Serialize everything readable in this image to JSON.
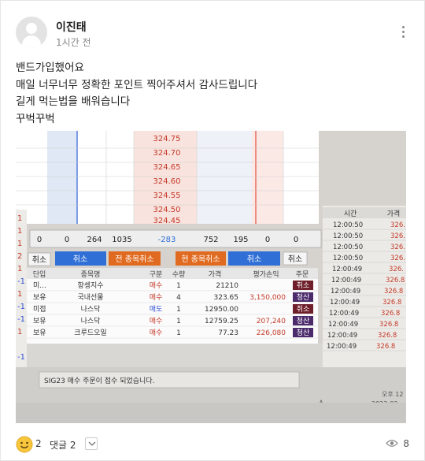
{
  "post": {
    "author": "이진태",
    "time": "1시간 전",
    "body_lines": [
      "밴드가입했어요",
      "매일 너무너무 정확한 포인트 찍어주셔서 감사드립니다",
      "길게 먹는법을 배워습니다",
      "꾸벅꾸벅"
    ]
  },
  "photo": {
    "price_ladder": [
      "324.75",
      "324.70",
      "324.65",
      "324.60",
      "324.55",
      "324.50",
      "324.45"
    ],
    "left_margin_numbers": [
      "1",
      "1",
      "1",
      "2",
      "1",
      "-1",
      "1",
      "-1",
      "-1",
      "1",
      "-1"
    ],
    "summary_row": [
      "0",
      "0",
      "264",
      "1035",
      "-283",
      "752",
      "195",
      "0",
      "0"
    ],
    "buttons": {
      "cancel1": "취소",
      "all_cancel": "전 종목취소",
      "current_cancel": "현 종목취소",
      "cancel2": "취소",
      "cancel3": "취소",
      "left_cancel": "취소"
    },
    "table": {
      "headers": [
        "단입",
        "종목명",
        "구분",
        "수량",
        "가격",
        "평가손익",
        "주문"
      ],
      "rows": [
        {
          "type": "미...",
          "name": "항셍지수",
          "side": "매수",
          "qty": "1",
          "price": "21210",
          "pnl": "",
          "action": "취소"
        },
        {
          "type": "보유",
          "name": "국내선물",
          "side": "매수",
          "qty": "4",
          "price": "323.65",
          "pnl": "3,150,000",
          "action": "청산"
        },
        {
          "type": "미접",
          "name": "나스닥",
          "side": "매도",
          "qty": "1",
          "price": "12950.00",
          "pnl": "",
          "action": "취소"
        },
        {
          "type": "보유",
          "name": "나스닥",
          "side": "매수",
          "qty": "1",
          "price": "12759.25",
          "pnl": "207,240",
          "action": "청산"
        },
        {
          "type": "보유",
          "name": "크루드오일",
          "side": "매수",
          "qty": "1",
          "price": "77.23",
          "pnl": "226,080",
          "action": "청산"
        }
      ]
    },
    "right_panel": {
      "headers": [
        "시간",
        "가격"
      ],
      "times": [
        "12:00:50",
        "12:00:50",
        "12:00:50",
        "12:00:50",
        "12:00:49",
        "12:00:49",
        "12:00:49",
        "12:00:49",
        "12:00:49",
        "12:00:49",
        "12:00:49",
        "12:00:49"
      ],
      "prices": [
        "326.",
        "326.",
        "326.",
        "326.",
        "326.",
        "326.8",
        "326.8",
        "326.8",
        "326.8",
        "326.8",
        "326.8",
        "326.8"
      ]
    },
    "status_message": "SIG23 매수 주문이 접수 되었습니다.",
    "taskbar": {
      "clock": "오후 12",
      "date": "2023-02-"
    }
  },
  "footer": {
    "reaction_count": "2",
    "comment_label": "댓글 2",
    "view_count": "8"
  },
  "colors": {
    "red": "#d23a2e",
    "blue": "#2f6fd6",
    "orange": "#e06a1f",
    "maroon": "#6e1f2a",
    "purple": "#4b2b6b"
  }
}
